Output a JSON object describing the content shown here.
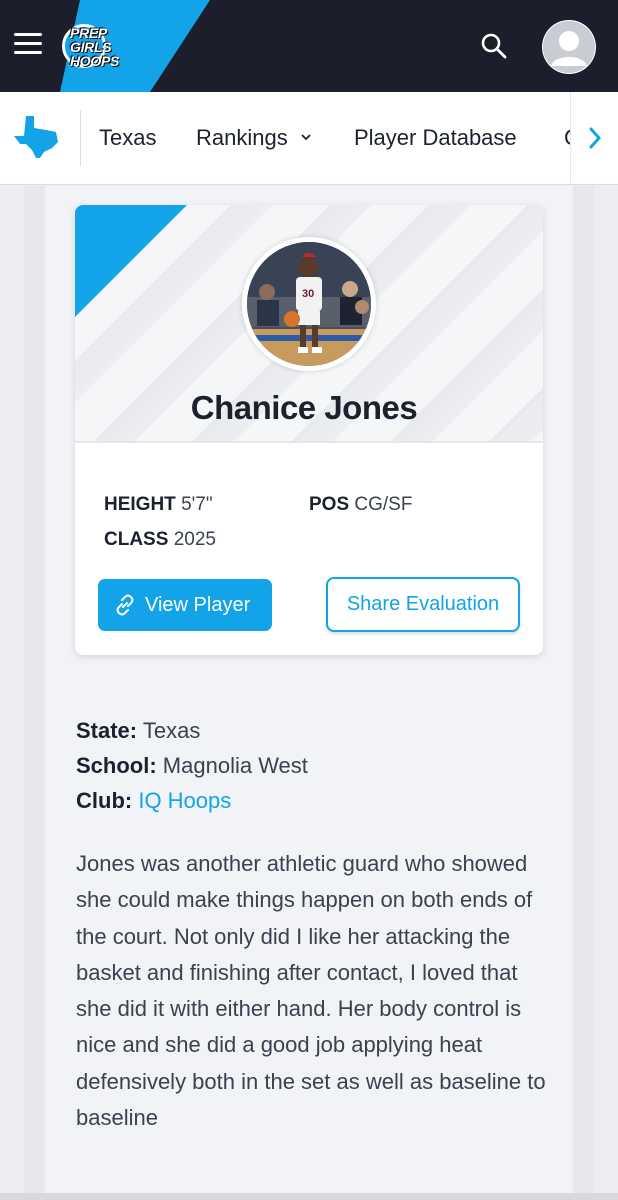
{
  "header": {
    "logo_text": [
      "PREP",
      "GIRLS",
      "HOOPS"
    ],
    "menu_icon": "hamburger-icon",
    "search_icon": "search-icon",
    "avatar_icon": "user-avatar-icon"
  },
  "nav": {
    "state_icon": "texas-map-icon",
    "items": [
      {
        "label": "Texas"
      },
      {
        "label": "Rankings",
        "icon": "chevron-down-icon"
      },
      {
        "label": "Player Database"
      },
      {
        "label": "C"
      }
    ],
    "next_icon": "chevron-right-icon"
  },
  "colors": {
    "accent": "#12a3e8",
    "topbar": "#1c1f2b",
    "text": "#1c2130"
  },
  "card": {
    "name": "Chanice Jones",
    "jersey": "30",
    "height_label": "HEIGHT",
    "height_value": "5'7\"",
    "pos_label": "POS",
    "pos_value": "CG/SF",
    "class_label": "CLASS",
    "class_value": "2025",
    "view_button": "View Player",
    "share_button": "Share Evaluation"
  },
  "details": {
    "state_label": "State:",
    "state_value": "Texas",
    "school_label": "School:",
    "school_value": "Magnolia West",
    "club_label": "Club:",
    "club_value": "IQ Hoops"
  },
  "evaluation": "Jones was another athletic guard who showed she could make things happen on both ends of the court. Not only did I like her attacking the basket and finishing after contact, I loved that she did it with either hand. Her body control is nice and she did a good job applying heat defensively both in the set as well as baseline to baseline"
}
